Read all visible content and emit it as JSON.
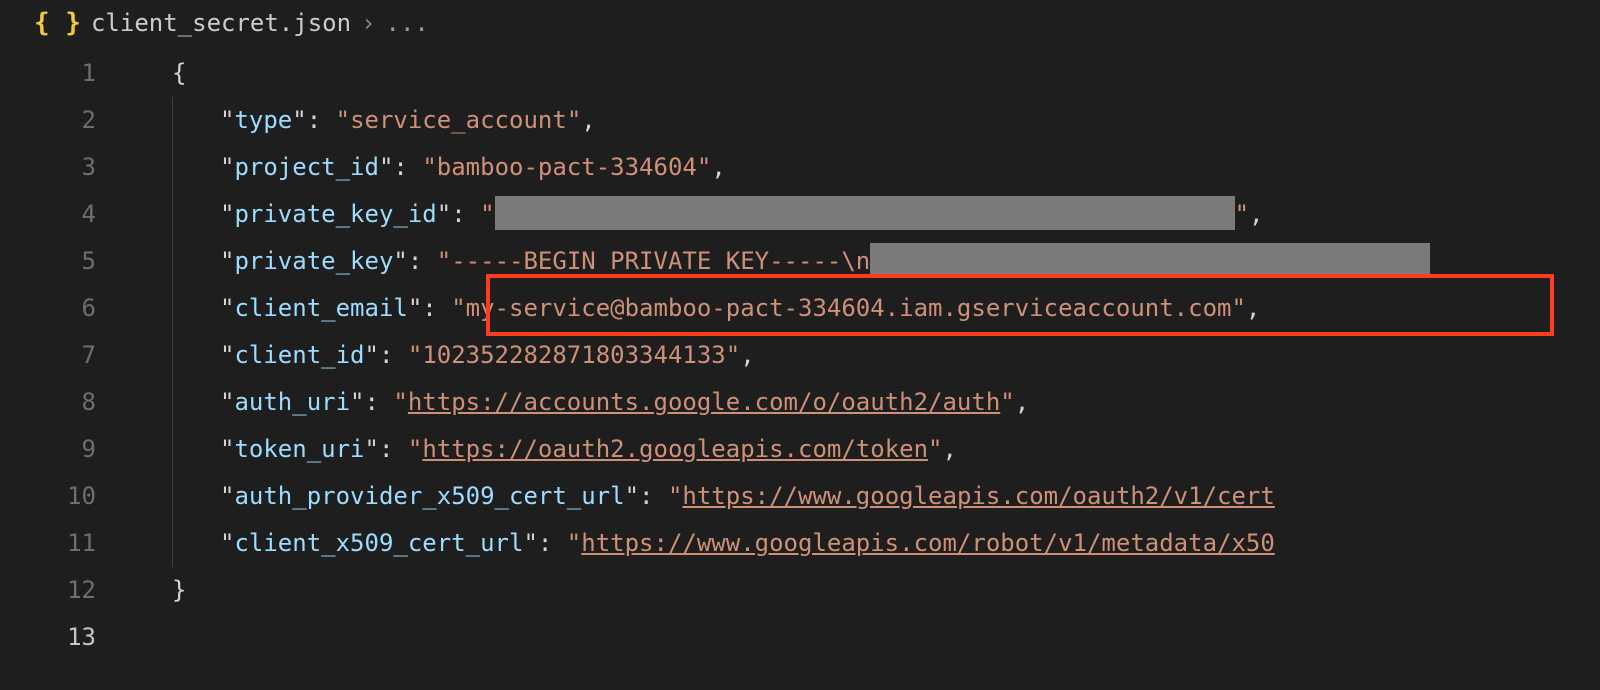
{
  "breadcrumb": {
    "icon": "braces-icon",
    "filename": "client_secret.json",
    "suffix": "..."
  },
  "lines": {
    "l1": "1",
    "l2": "2",
    "l3": "3",
    "l4": "4",
    "l5": "5",
    "l6": "6",
    "l7": "7",
    "l8": "8",
    "l9": "9",
    "l10": "10",
    "l11": "11",
    "l12": "12",
    "l13": "13"
  },
  "syntax": {
    "open_brace": "{",
    "close_brace": "}",
    "colon": ":",
    "comma": ",",
    "quote": "\"",
    "space": " "
  },
  "json_keys": {
    "type": "type",
    "project_id": "project_id",
    "private_key_id": "private_key_id",
    "private_key": "private_key",
    "client_email": "client_email",
    "client_id": "client_id",
    "auth_uri": "auth_uri",
    "token_uri": "token_uri",
    "auth_provider_x509_cert_url": "auth_provider_x509_cert_url",
    "client_x509_cert_url": "client_x509_cert_url"
  },
  "json_values": {
    "type": "service_account",
    "project_id": "bamboo-pact-334604",
    "private_key_id_redacted": true,
    "private_key_prefix": "-----BEGIN PRIVATE KEY-----\\n",
    "private_key_rest_redacted": true,
    "client_email": "my-service@bamboo-pact-334604.iam.gserviceaccount.com",
    "client_id": "102352282871803344133",
    "auth_uri": "https://accounts.google.com/o/oauth2/auth",
    "token_uri": "https://oauth2.googleapis.com/token",
    "auth_provider_x509_cert_url": "https://www.googleapis.com/oauth2/v1/cert",
    "client_x509_cert_url": "https://www.googleapis.com/robot/v1/metadata/x50"
  },
  "highlight": {
    "target_key": "client_email",
    "color": "#ff3b20"
  }
}
